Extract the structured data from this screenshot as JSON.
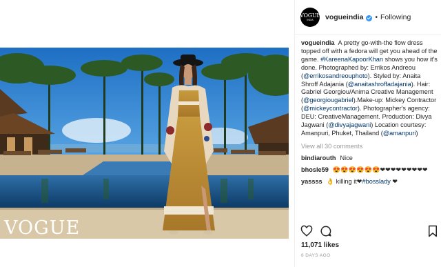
{
  "post": {
    "username": "vogueindia",
    "follow_state": "Following",
    "dot": "•",
    "avatar_text": "VOGUE",
    "avatar_subtext": "INDIA",
    "photo_watermark": "VOGUE",
    "caption": {
      "username": "vogueindia",
      "t1": " A pretty go-with-the flow dress topped off with a fedora will get you ahead of the game. ",
      "tag1": "#KareenaKapoorKhan",
      "t2": " shows you how it's done. Photographed by: Errikos Andreou (",
      "m1": "@errikosandreouphoto",
      "t3": "). Styled by: Anaita Shroff Adajania (",
      "m2": "@anaitashroffadajania",
      "t4": "). Hair: Gabriel Georgiou/Anima Creative Management (",
      "m3": "@georgiougabriel",
      "t5": ").Make-up: Mickey Contractor (",
      "m4": "@mickeycontractor",
      "t6": "). Photographer's agency: DEU: CreativeManagement. Production: Divya Jagwani (",
      "m5": "@divyajagwani",
      "t7": ") Location courtesy: Amanpuri, Phuket, Thailand (",
      "m6": "@amanpuri",
      "t8": ")"
    },
    "view_all": "View all 30 comments",
    "comments": [
      {
        "username": "bindiarouth",
        "text": "Nice"
      },
      {
        "username": "bhosle59",
        "text": "😍😍😍😍😍😍❤❤❤❤❤❤❤❤❤"
      },
      {
        "username": "yassss",
        "text": "👌 killing it❤",
        "link": "#bosslady",
        "tail": " ❤"
      }
    ],
    "likes": "11,071 likes",
    "time": "6 DAYS AGO"
  },
  "colors": {
    "link": "#003569",
    "verified": "#3897f0",
    "muted": "#999999"
  },
  "icons": [
    "verified-badge-icon",
    "heart-icon",
    "comment-icon",
    "bookmark-icon"
  ]
}
